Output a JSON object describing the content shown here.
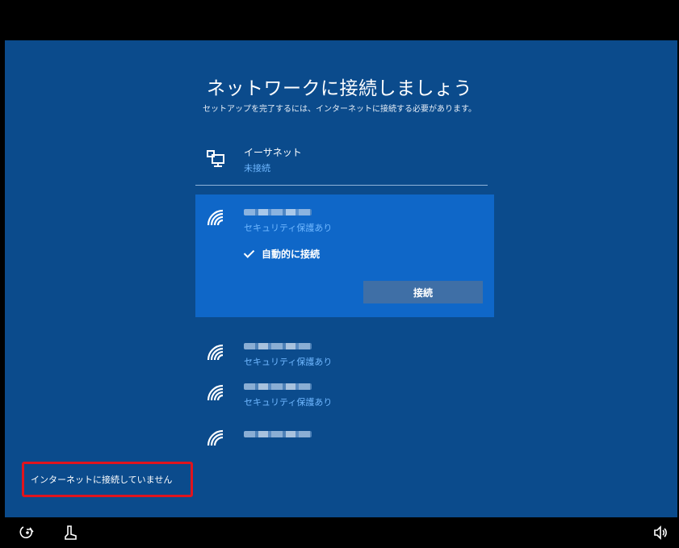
{
  "header": {
    "title": "ネットワークに接続しましょう",
    "subtitle": "セットアップを完了するには、インターネットに接続する必要があります。"
  },
  "ethernet": {
    "name": "イーサネット",
    "status": "未接続",
    "icon": "ethernet-icon"
  },
  "networks": [
    {
      "status": "セキュリティ保護あり",
      "icon": "wifi-icon",
      "selected": true,
      "auto_connect_label": "自動的に接続",
      "auto_connect_checked": true,
      "connect_button": "接続"
    },
    {
      "status": "セキュリティ保護あり",
      "icon": "wifi-icon"
    },
    {
      "status": "セキュリティ保護あり",
      "icon": "wifi-icon"
    },
    {
      "icon": "wifi-icon"
    }
  ],
  "footer": {
    "no_internet_link": "インターネットに接続していません",
    "icons": [
      "ease-of-access-icon",
      "input-method-icon",
      "volume-icon"
    ]
  },
  "colors": {
    "background": "#0b4b8c",
    "selected_item": "#0f67c8",
    "status_text": "#6fb7ff",
    "connect_button": "#3f6fa6",
    "highlight_border": "#e0141d"
  }
}
